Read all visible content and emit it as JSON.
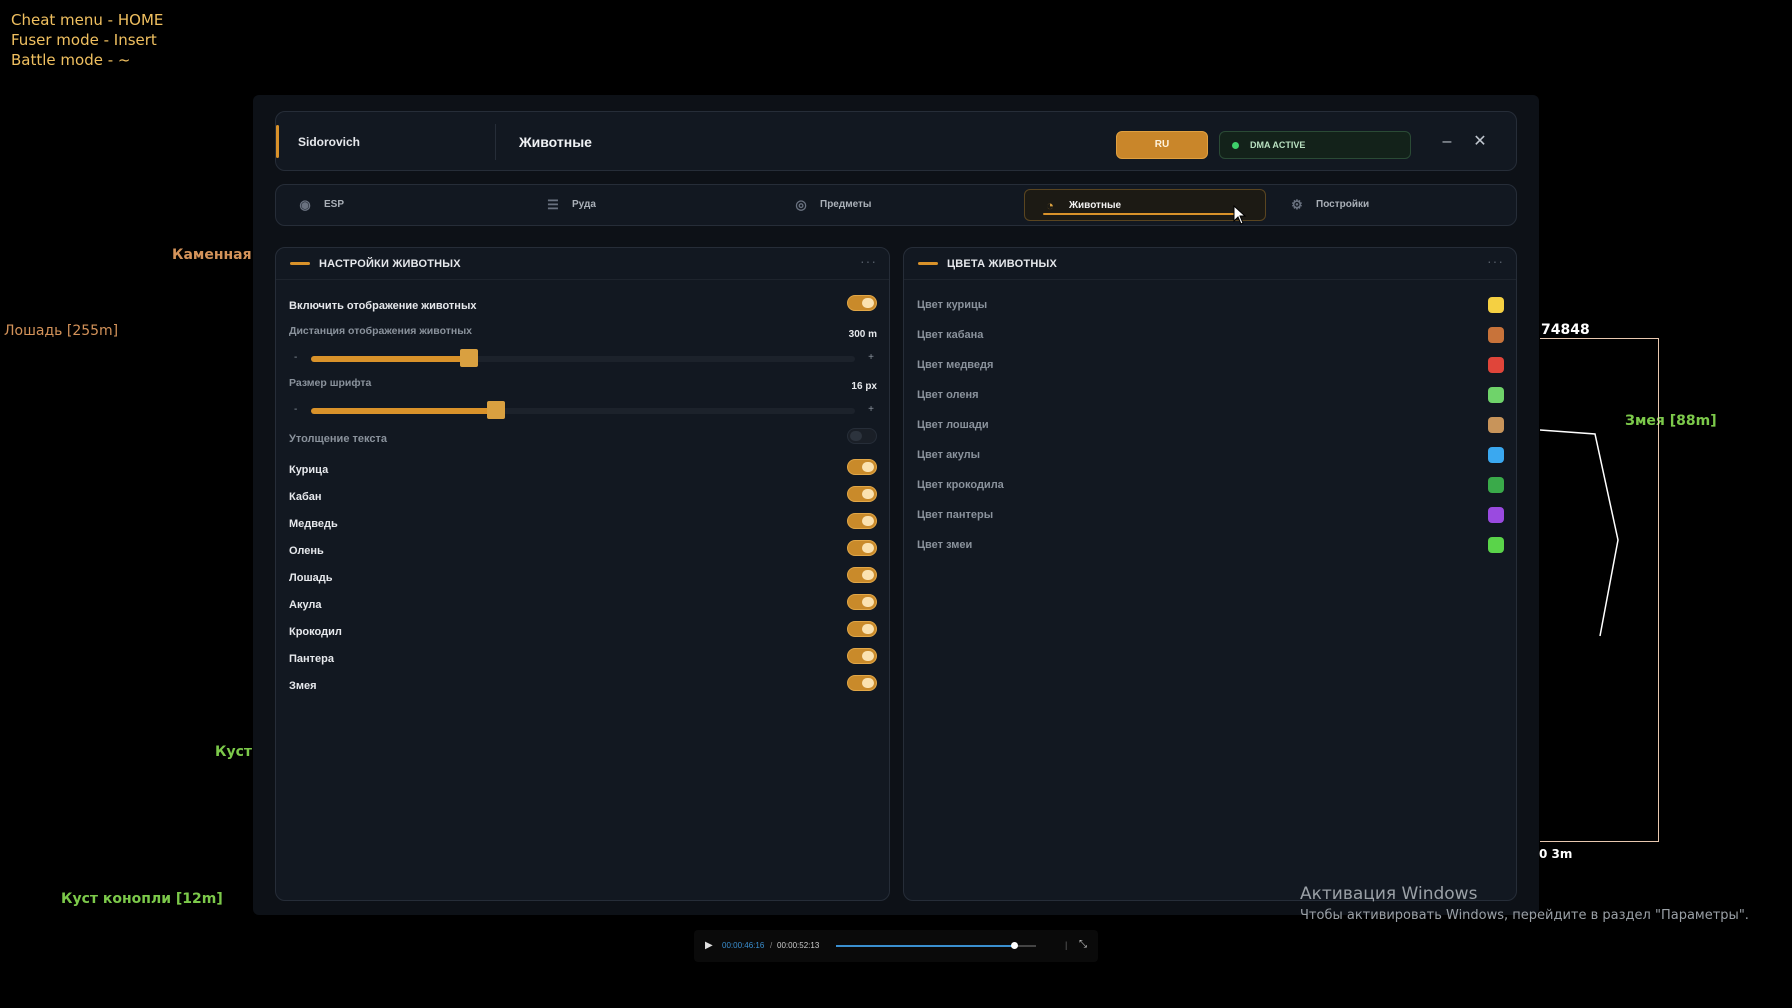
{
  "hints": [
    "Cheat menu - HOME",
    "Fuser mode - Insert",
    "Battle mode - ~"
  ],
  "esp_labels": {
    "stone": "Каменная р",
    "horse": "Лошадь [255m]",
    "bush_partial": "Куст к",
    "bush": "Куст конопли [12m]",
    "snake": "Змея [88m]",
    "id_number": "74848",
    "distance": "0 3m"
  },
  "window": {
    "app_name": "Sidorovich",
    "page_title": "Животные",
    "lang_button": "RU",
    "dma_status": "DMA ACTIVE",
    "minimize_glyph": "–",
    "close_glyph": "✕"
  },
  "tabs": [
    {
      "label": "ESP",
      "icon": "eye-icon"
    },
    {
      "label": "Руда",
      "icon": "sliders-icon"
    },
    {
      "label": "Предметы",
      "icon": "target-icon"
    },
    {
      "label": "Животные",
      "icon": "gauge-icon"
    },
    {
      "label": "Постройки",
      "icon": "gear-icon"
    }
  ],
  "active_tab": "Животные",
  "settings": {
    "title": "НАСТРОЙКИ ЖИВОТНЫХ",
    "enable_label": "Включить отображение животных",
    "enable_on": true,
    "distance_label": "Дистанция отображения животных",
    "distance_value": "300 m",
    "distance_fraction": 0.29,
    "font_label": "Размер шрифта",
    "font_value": "16 px",
    "font_fraction": 0.34,
    "slider_minus": "-",
    "slider_plus": "+",
    "bold_label": "Утолщение текста",
    "bold_on": false,
    "animals": [
      {
        "label": "Курица",
        "on": true
      },
      {
        "label": "Кабан",
        "on": true
      },
      {
        "label": "Медведь",
        "on": true
      },
      {
        "label": "Олень",
        "on": true
      },
      {
        "label": "Лошадь",
        "on": true
      },
      {
        "label": "Акула",
        "on": true
      },
      {
        "label": "Крокодил",
        "on": true
      },
      {
        "label": "Пантера",
        "on": true
      },
      {
        "label": "Змея",
        "on": true
      }
    ]
  },
  "colors": {
    "title": "ЦВЕТА ЖИВОТНЫХ",
    "items": [
      {
        "label": "Цвет курицы",
        "color": "#f5d042"
      },
      {
        "label": "Цвет кабана",
        "color": "#c8733a"
      },
      {
        "label": "Цвет медведя",
        "color": "#e0453a"
      },
      {
        "label": "Цвет оленя",
        "color": "#6fd36a"
      },
      {
        "label": "Цвет лошади",
        "color": "#c8945a"
      },
      {
        "label": "Цвет акулы",
        "color": "#3aa8f0"
      },
      {
        "label": "Цвет крокодила",
        "color": "#3aaa4a"
      },
      {
        "label": "Цвет пантеры",
        "color": "#9a4ae0"
      },
      {
        "label": "Цвет змеи",
        "color": "#5ad44a"
      }
    ]
  },
  "activation": {
    "title": "Активация Windows",
    "subtitle": "Чтобы активировать Windows, перейдите в раздел \"Параметры\"."
  },
  "player": {
    "current": "00:00:46:16",
    "separator": "/",
    "duration": "00:00:52:13",
    "progress": 0.89
  }
}
